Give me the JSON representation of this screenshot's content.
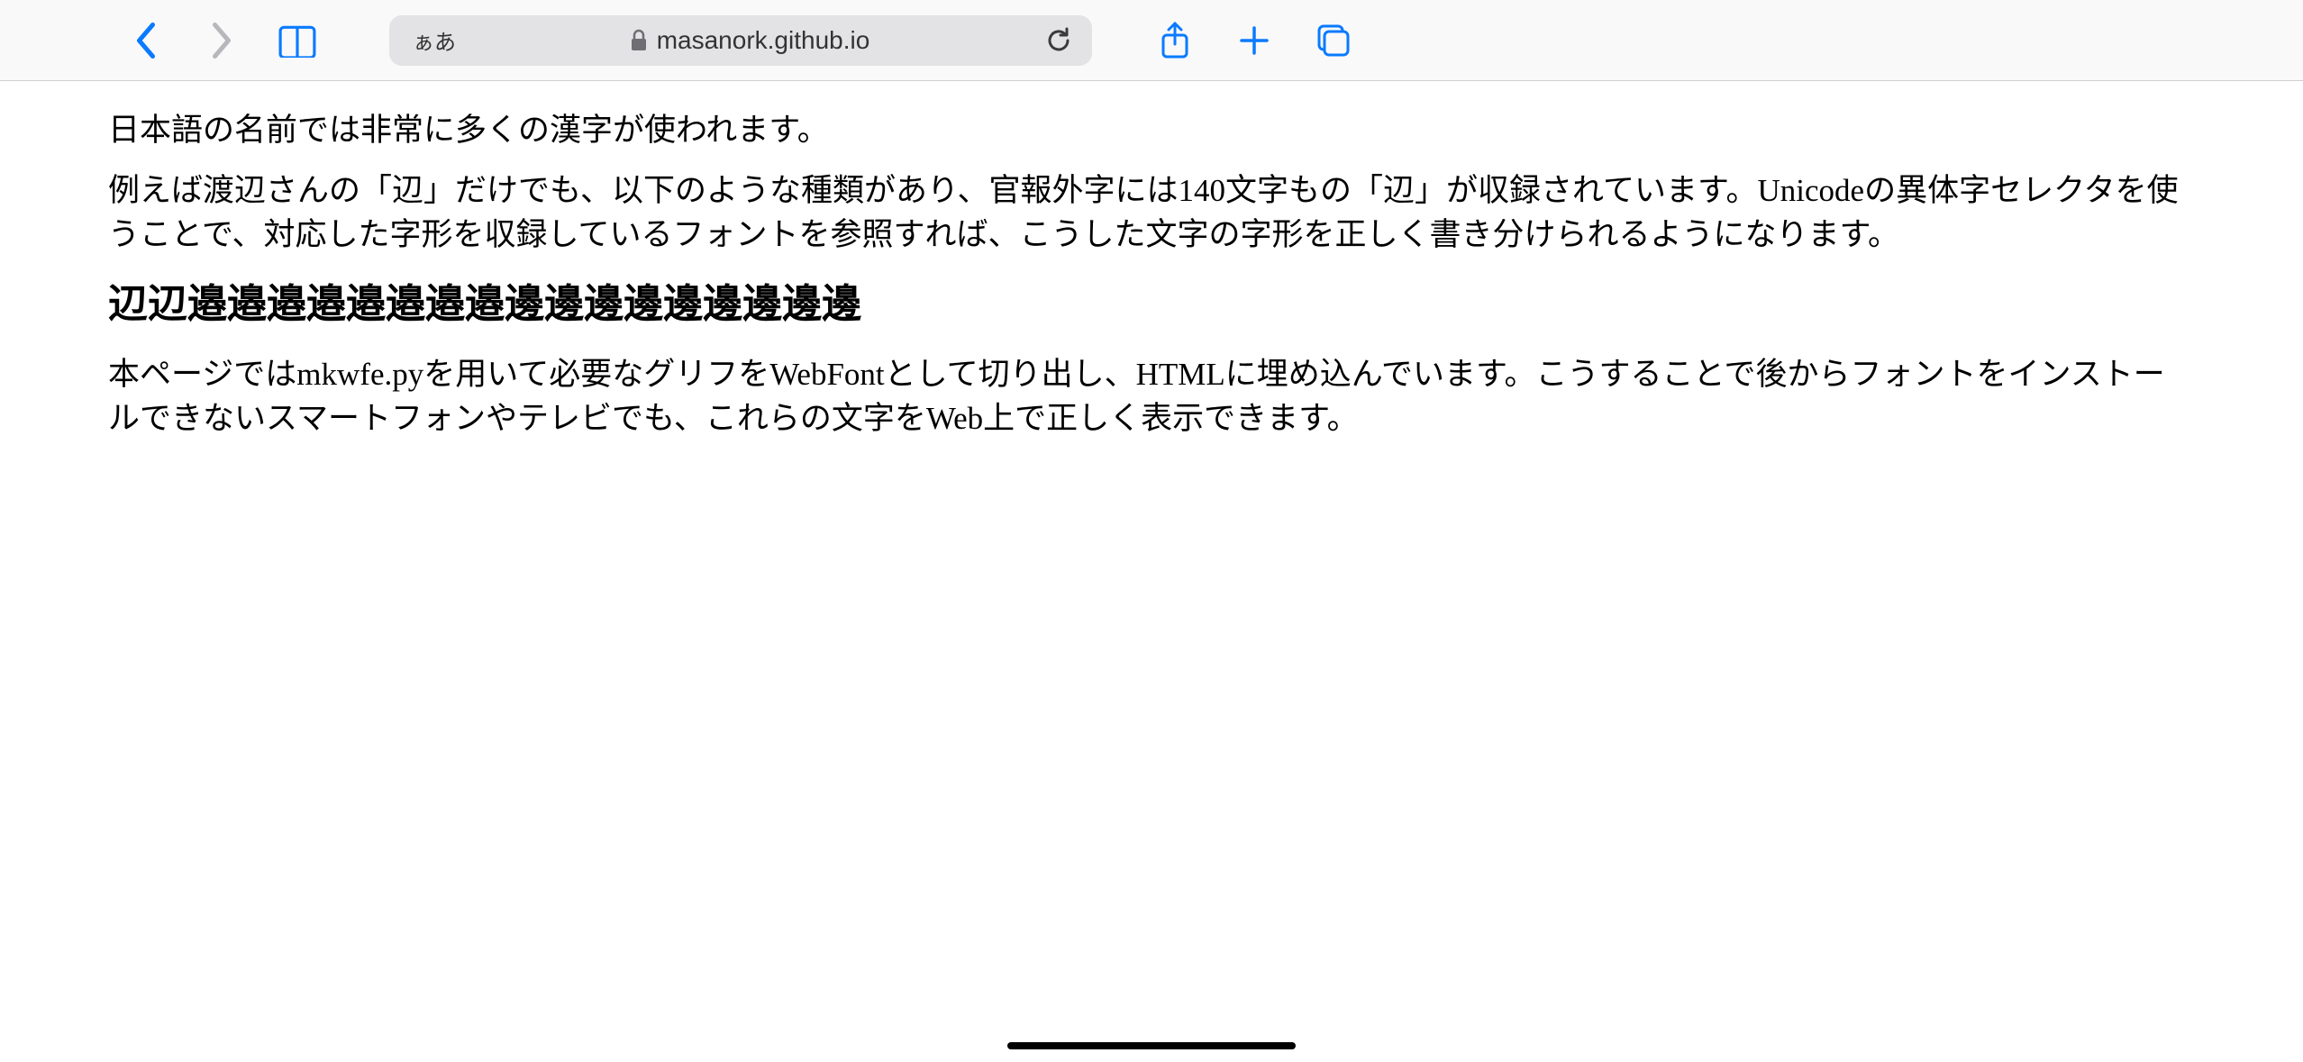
{
  "toolbar": {
    "text_size_label": "ぁあ",
    "url": "masanork.github.io"
  },
  "content": {
    "p1": "日本語の名前では非常に多くの漢字が使われます。",
    "p2": "例えば渡辺さんの「辺」だけでも、以下のような種類があり、官報外字には140文字もの「辺」が収録されています。Unicodeの異体字セレクタを使うことで、対応した字形を収録しているフォントを参照すれば、こうした文字の字形を正しく書き分けられるようになります。",
    "variants_heading": "辺辺邉邉邉邉邉邉邉邉邊邊邊邊邊邊邊邊邊",
    "p3": "本ページではmkwfe.pyを用いて必要なグリフをWebFontとして切り出し、HTMLに埋め込んでいます。こうすることで後からフォントをインストールできないスマートフォンやテレビでも、これらの文字をWeb上で正しく表示できます。"
  }
}
